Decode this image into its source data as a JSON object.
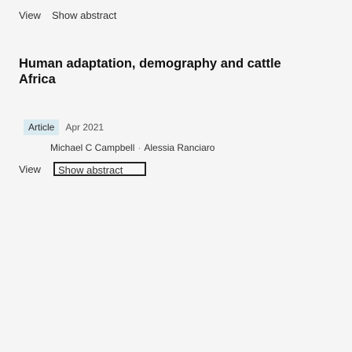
{
  "top_actions": {
    "view_label": "View",
    "show_abstract_label": "Show abstract"
  },
  "publication": {
    "title_line1": "Human adaptation, demography and cattle",
    "title_line2": "Africa",
    "type": "Article",
    "date": "Apr 2021",
    "authors": [
      "Michael C Campbell",
      "Alessia Ranciaro"
    ],
    "author_separator": "·"
  },
  "bottom_actions": {
    "view_label": "View",
    "show_abstract_label": "Show abstract"
  }
}
